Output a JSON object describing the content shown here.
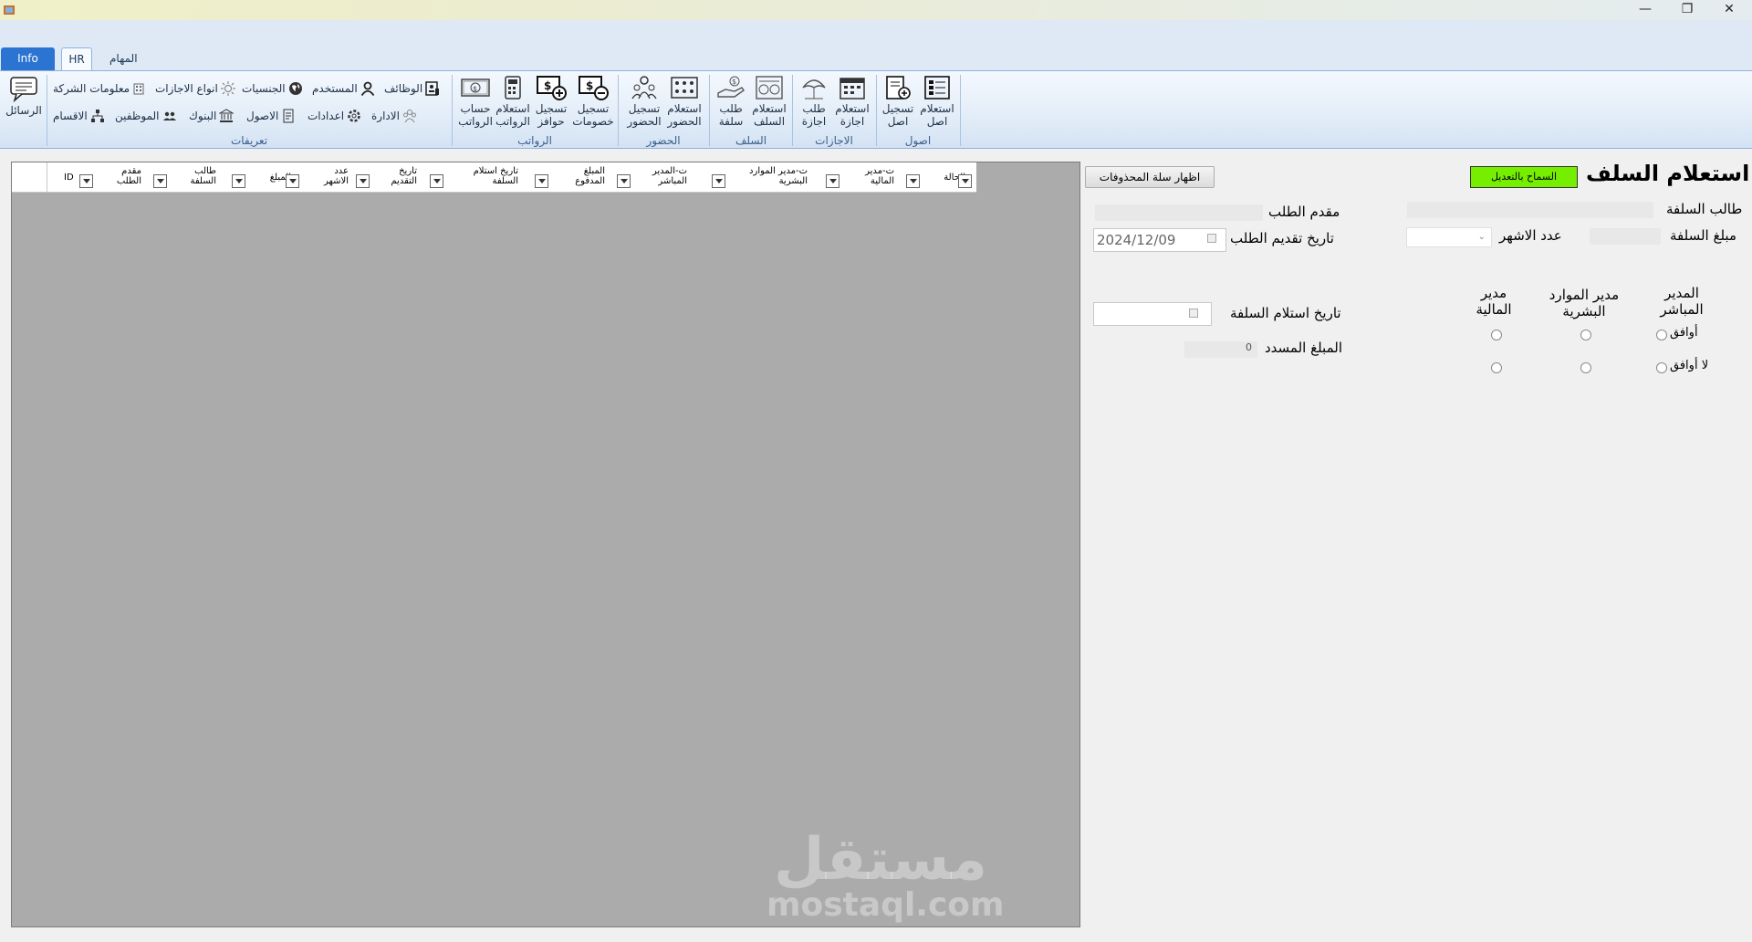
{
  "window": {
    "minimize": "—",
    "restore": "❐",
    "close": "✕"
  },
  "tabs": {
    "info": "Info",
    "hr": "HR",
    "tasks": "المهام"
  },
  "ribbon": {
    "messages": "الرسائل",
    "defs": {
      "company_info": "معلومات الشركة",
      "leave_types": "انواع الاجازات",
      "nationalities": "الجنسيات",
      "user": "المستخدم",
      "jobs": "الوظائف",
      "departments": "الاقسام",
      "employees": "الموظفين",
      "banks": "البنوك",
      "assets": "الاصول",
      "settings": "اعدادات",
      "admin": "الادارة",
      "group": "تعريفات"
    },
    "salaries": {
      "calc": [
        "حساب",
        "الرواتب"
      ],
      "query": [
        "استعلام",
        "الرواتب"
      ],
      "bonus": [
        "تسجيل",
        "حوافز"
      ],
      "deduct": [
        "تسجيل",
        "خصومات"
      ],
      "group": "الرواتب"
    },
    "attendance": {
      "record": [
        "تسجيل",
        "الحضور"
      ],
      "query": [
        "استعلام",
        "الحضور"
      ],
      "group": "الحضور"
    },
    "loans": {
      "request": [
        "طلب",
        "سلفة"
      ],
      "query": [
        "استعلام",
        "السلف"
      ],
      "group": "السلف"
    },
    "leaves": {
      "request": [
        "طلب",
        "اجازة"
      ],
      "query": [
        "استعلام",
        "اجازة"
      ],
      "group": "الاجازات"
    },
    "assets": {
      "record": [
        "تسجيل",
        "اصل"
      ],
      "query": [
        "استعلام",
        "اصل"
      ],
      "group": "اصول"
    }
  },
  "grid": {
    "columns": [
      {
        "l1": "ID",
        "l2": ""
      },
      {
        "l1": "مقدم",
        "l2": "الطلب"
      },
      {
        "l1": "طالب",
        "l2": "السلفة"
      },
      {
        "l1": "المبلغ",
        "l2": ""
      },
      {
        "l1": "عدد",
        "l2": "الاشهر"
      },
      {
        "l1": "تاريخ",
        "l2": "التقديم"
      },
      {
        "l1": "تاريخ استلام",
        "l2": "السلفة"
      },
      {
        "l1": "المبلغ",
        "l2": "المدفوع"
      },
      {
        "l1": "ت-المدير",
        "l2": "المباشر"
      },
      {
        "l1": "ت-مدير الموارد",
        "l2": "البشرية"
      },
      {
        "l1": "ت-مدير",
        "l2": "المالية"
      },
      {
        "l1": "الحالة",
        "l2": ""
      }
    ],
    "watermark_ar": "مستقل",
    "watermark_en": "mostaql.com"
  },
  "form": {
    "title": "استعلام السلف",
    "allow_edit": "السماح بالتعديل",
    "show_deleted": "اظهار سلة المحذوفات",
    "borrower": "طالب السلفة",
    "requester": "مقدم الطلب",
    "amount": "مبلغ السلفة",
    "months": "عدد الاشهر",
    "request_date_label": "تاريخ تقديم الطلب",
    "request_date_value": "2024/12/09",
    "direct_manager": [
      "المدير",
      "المباشر"
    ],
    "hr_manager": [
      "مدير الموارد",
      "البشرية"
    ],
    "finance_manager": [
      "مدير",
      "المالية"
    ],
    "approve": "أوافق",
    "reject": "لا أوافق",
    "receive_date_label": "تاريخ استلام السلفة",
    "paid_amount_label": "المبلغ المسدد",
    "paid_amount_value": "0"
  },
  "colors": {
    "allow_edit_bg": "#76ee00",
    "info_tab": "#2b74d1",
    "grid_bg": "#ababab"
  }
}
